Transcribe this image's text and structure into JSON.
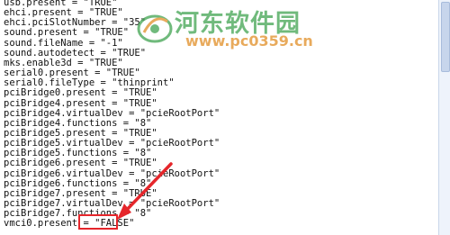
{
  "editor": {
    "lines": [
      "usb.present = \"TRUE\"",
      "ehci.present = \"TRUE\"",
      "ehci.pciSlotNumber = \"35\"",
      "sound.present = \"TRUE\"",
      "sound.fileName = \"-1\"",
      "sound.autodetect = \"TRUE\"",
      "mks.enable3d = \"TRUE\"",
      "serial0.present = \"TRUE\"",
      "serial0.fileType = \"thinprint\"",
      "pciBridge0.present = \"TRUE\"",
      "pciBridge4.present = \"TRUE\"",
      "pciBridge4.virtualDev = \"pcieRootPort\"",
      "pciBridge4.functions = \"8\"",
      "pciBridge5.present = \"TRUE\"",
      "pciBridge5.virtualDev = \"pcieRootPort\"",
      "pciBridge5.functions = \"8\"",
      "pciBridge6.present = \"TRUE\"",
      "pciBridge6.virtualDev = \"pcieRootPort\"",
      "pciBridge6.functions = \"8\"",
      "pciBridge7.present = \"TRUE\"",
      "pciBridge7.virtualDev = \"pcieRootPort\"",
      "pciBridge7.functions = \"8\"",
      "vmci0.present = \"FALSE\""
    ],
    "highlighted_value": "\"FALSE\""
  },
  "watermark": {
    "site_name": "河东软件园",
    "url": "www.pc0359.cn"
  },
  "colors": {
    "annotation_red": "#e5262b",
    "watermark_green": "#3aa04a",
    "watermark_orange": "#e08a1e"
  }
}
